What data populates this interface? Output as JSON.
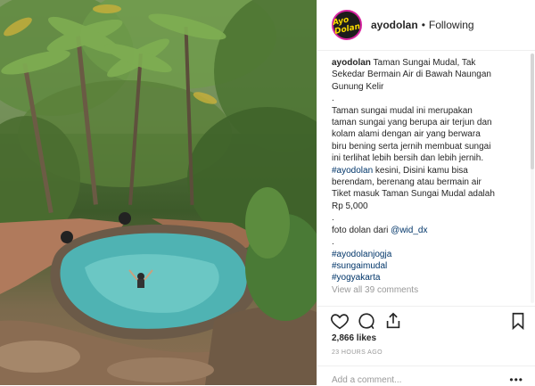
{
  "post": {
    "username": "ayodolan",
    "separator": "•",
    "follow_state": "Following",
    "avatar_text": "Ayo Dolan",
    "caption_lines": [
      {
        "text": "ayodolan Taman Sungai Mudal, Tak",
        "kind": "normal"
      },
      {
        "text": "Sekedar Bermain Air di Bawah Naungan",
        "kind": "normal"
      },
      {
        "text": "Gunung Kelir",
        "kind": "normal"
      },
      {
        "text": ".",
        "kind": "normal"
      },
      {
        "text": "Taman sungai mudal ini merupakan",
        "kind": "normal"
      },
      {
        "text": "taman sungai yang berupa air terjun dan",
        "kind": "normal"
      },
      {
        "text": "kolam alami dengan air yang berwara",
        "kind": "normal"
      },
      {
        "text": "biru bening serta jernih membuat sungai",
        "kind": "normal"
      },
      {
        "text": "ini terlihat lebih bersih dan lebih jernih.",
        "kind": "normal"
      },
      {
        "text": "#ayodolan kesini, Disini kamu bisa",
        "kind": "mixed"
      },
      {
        "text": "berendam, berenang atau bermain air",
        "kind": "normal"
      },
      {
        "text": "Tiket masuk Taman Sungai Mudal adalah",
        "kind": "normal"
      },
      {
        "text": "Rp 5,000",
        "kind": "normal"
      },
      {
        "text": ".",
        "kind": "normal"
      },
      {
        "text": "foto dolan dari @wid_dx",
        "kind": "mixed2"
      },
      {
        "text": ".",
        "kind": "normal"
      },
      {
        "text": "#ayodolanjogja",
        "kind": "tag"
      },
      {
        "text": "#sungaimudal",
        "kind": "tag"
      },
      {
        "text": "#yogyakarta",
        "kind": "tag"
      },
      {
        "text": "View all 39 comments",
        "kind": "more"
      }
    ],
    "hashtag_ayodolan": "#ayodolan",
    "after_hashtag": " kesini, Disini kamu bisa",
    "photo_credit_prefix": "foto dolan dari ",
    "photo_credit_handle": "@wid_dx",
    "likes": "2,866 likes",
    "time": "23 HOURS AGO",
    "comment_placeholder": "Add a comment...",
    "more_options": "•••"
  },
  "icons": {
    "like": "heart-icon",
    "comment": "comment-icon",
    "share": "share-icon",
    "save": "bookmark-icon"
  },
  "colors": {
    "hashtag": "#003569",
    "muted": "#999999",
    "text": "#262626",
    "avatar_ring": "#d6249f",
    "avatar_text": "#f7d800"
  }
}
